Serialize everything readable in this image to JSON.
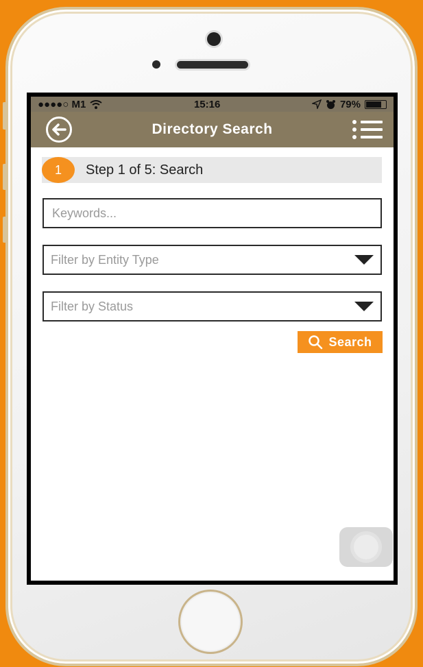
{
  "status_bar": {
    "carrier": "●●●●○ M1",
    "time": "15:16",
    "battery": "79%"
  },
  "header": {
    "title": "Directory Search"
  },
  "step": {
    "number": "1",
    "label": "Step 1 of 5: Search"
  },
  "form": {
    "keywords_placeholder": "Keywords...",
    "entity_type_placeholder": "Filter by Entity Type",
    "status_placeholder": "Filter by Status",
    "search_label": "Search"
  },
  "colors": {
    "accent": "#f5911f",
    "header_bg": "#877a5f",
    "page_bg": "#f08a0f"
  }
}
